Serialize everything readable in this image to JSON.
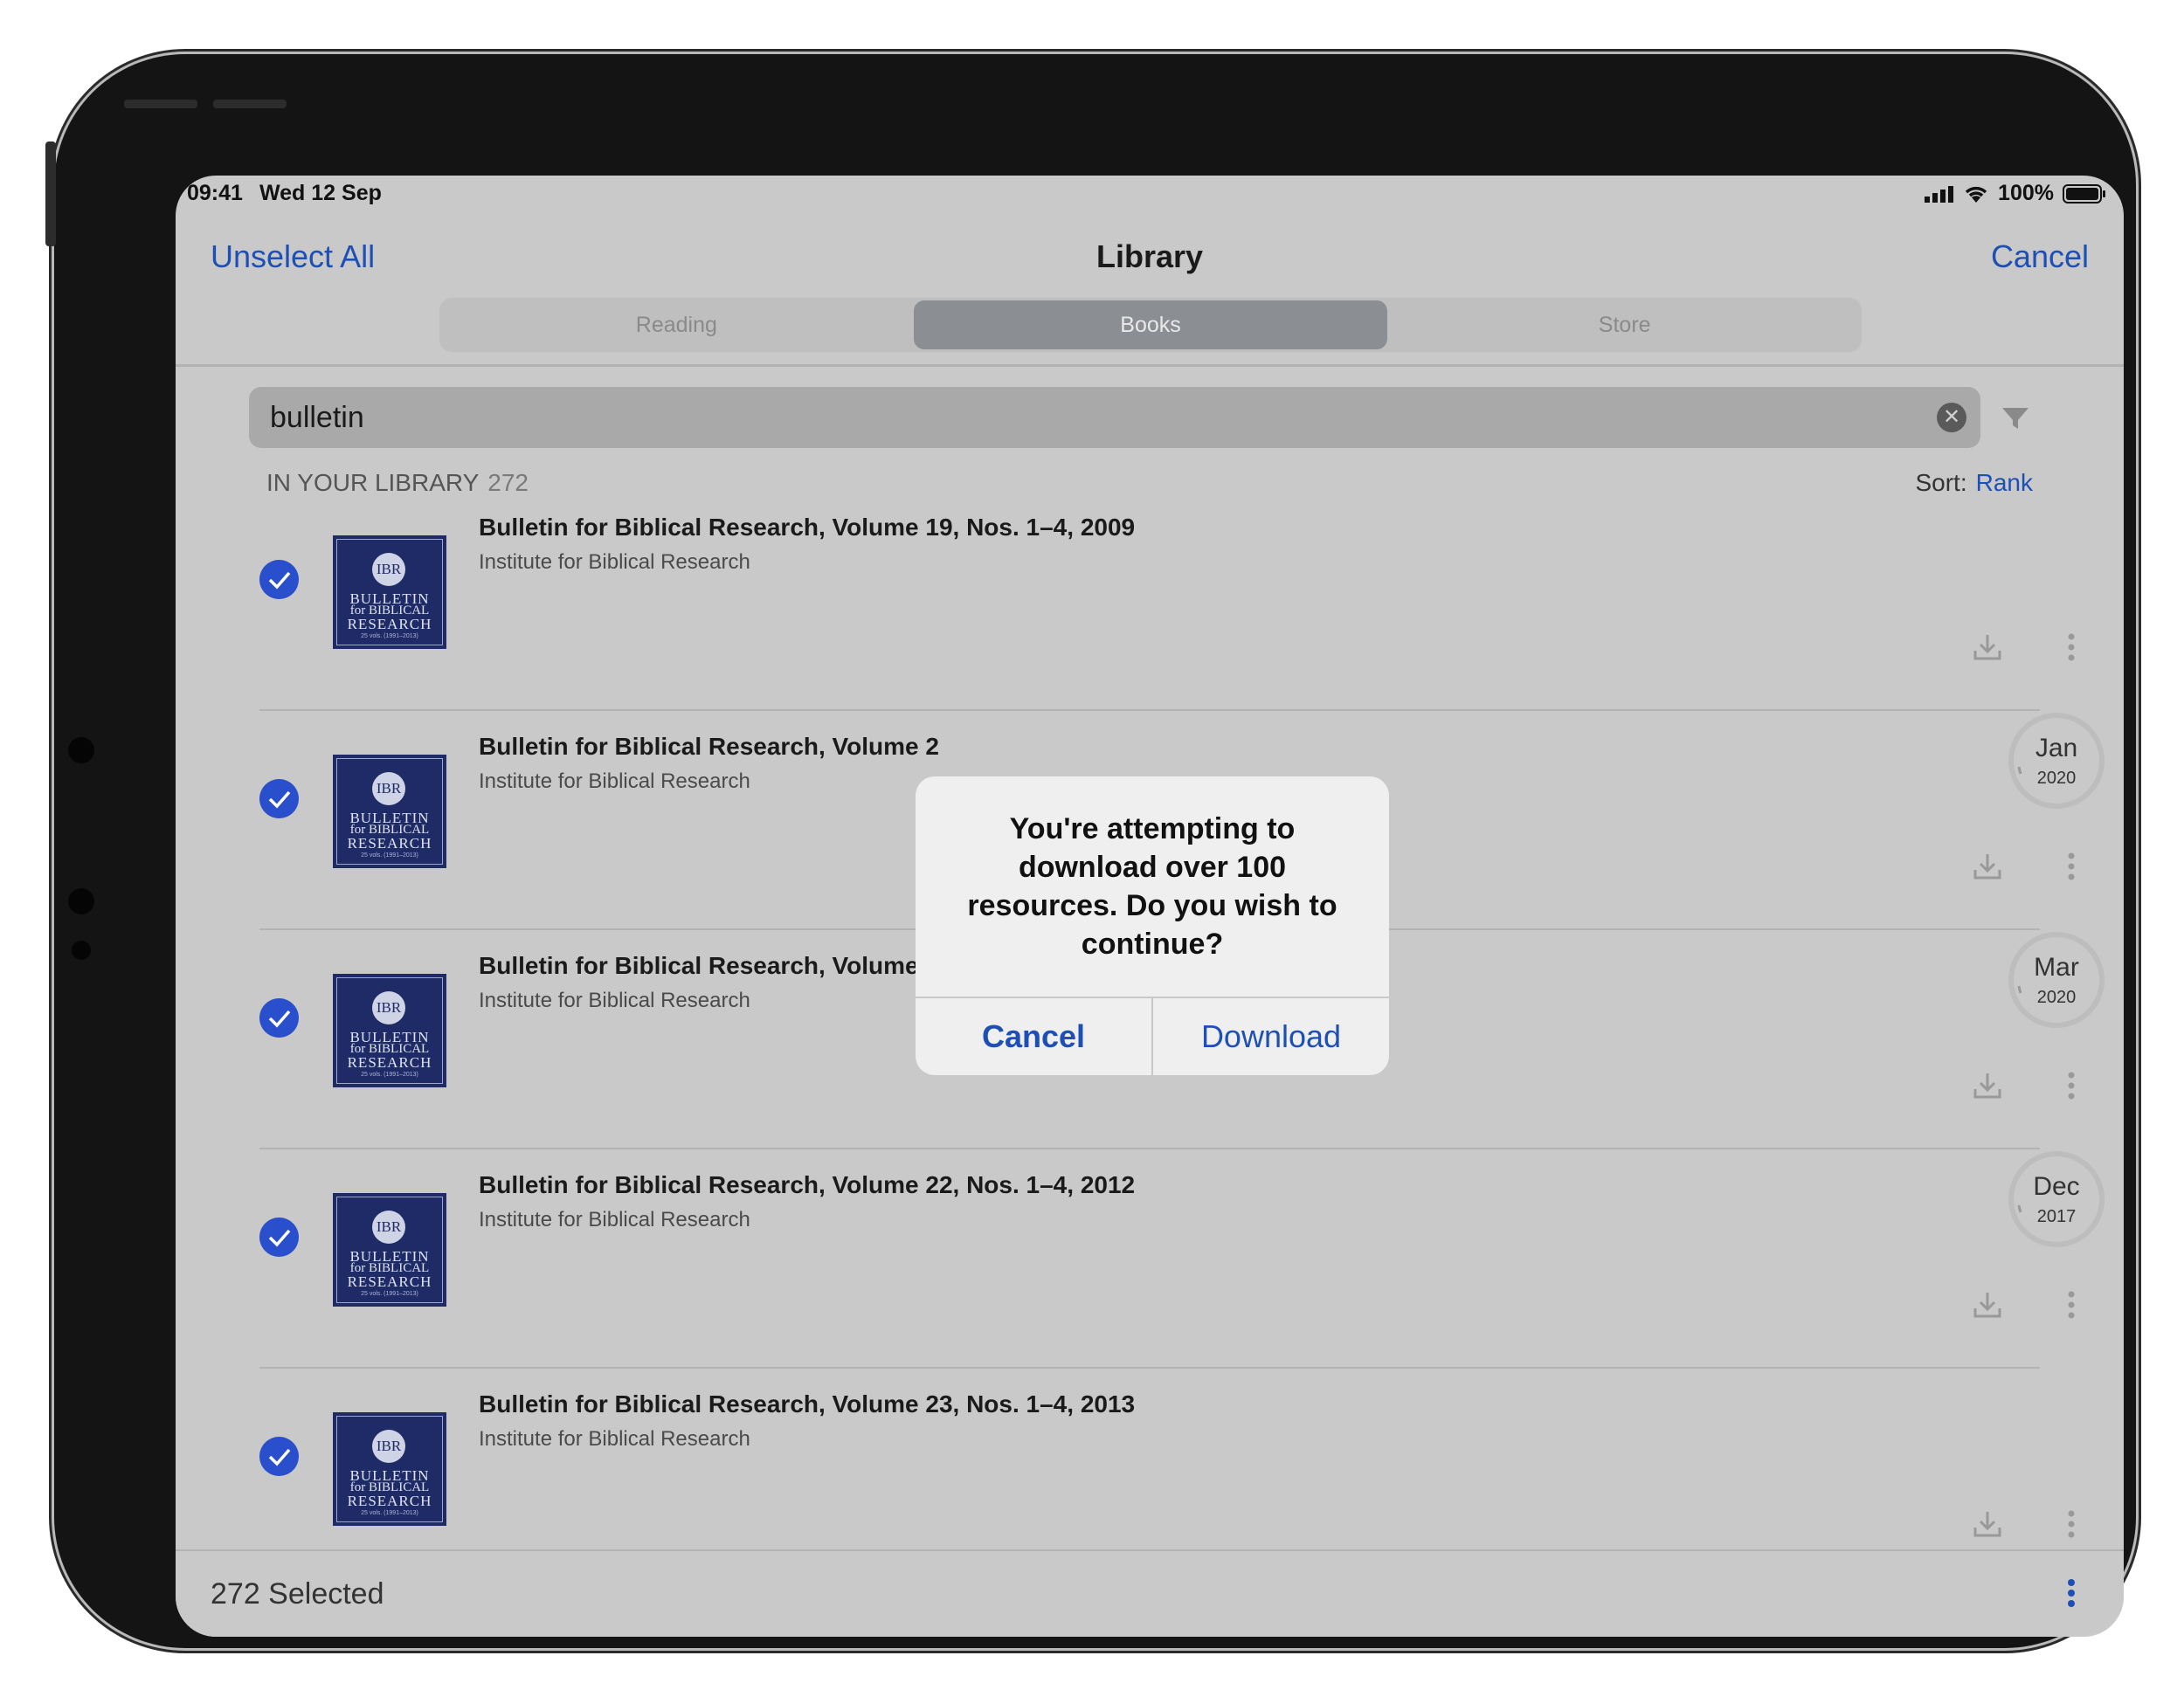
{
  "status": {
    "time": "09:41",
    "date": "Wed 12 Sep",
    "battery": "100%"
  },
  "nav": {
    "left": "Unselect All",
    "title": "Library",
    "right": "Cancel"
  },
  "tabs": [
    {
      "label": "Reading"
    },
    {
      "label": "Books",
      "active": true
    },
    {
      "label": "Store"
    }
  ],
  "search": {
    "value": "bulletin"
  },
  "library": {
    "label": "IN YOUR LIBRARY",
    "count": "272",
    "sort_label": "Sort:",
    "sort_value": "Rank"
  },
  "cover": {
    "seal": "IBR",
    "line1": "BULLETIN",
    "line2": "for BIBLICAL",
    "line3": "RESEARCH",
    "line4": "25 vols. (1991–2013)"
  },
  "items": [
    {
      "title": "Bulletin for Biblical Research, Volume 19, Nos. 1–4, 2009",
      "publisher": "Institute for Biblical Research",
      "badge": null
    },
    {
      "title": "Bulletin for Biblical Research, Volume 2",
      "publisher": "Institute for Biblical Research",
      "badge": {
        "month": "Jan",
        "year": "2020"
      }
    },
    {
      "title": "Bulletin for Biblical Research, Volume 2",
      "publisher": "Institute for Biblical Research",
      "badge": {
        "month": "Mar",
        "year": "2020"
      }
    },
    {
      "title": "Bulletin for Biblical Research, Volume 22, Nos. 1–4, 2012",
      "publisher": "Institute for Biblical Research",
      "badge": {
        "month": "Dec",
        "year": "2017"
      }
    },
    {
      "title": "Bulletin for Biblical Research, Volume 23, Nos. 1–4, 2013",
      "publisher": "Institute for Biblical Research",
      "badge": null
    }
  ],
  "bottom": {
    "selected": "272 Selected"
  },
  "dialog": {
    "message": "You're attempting to download over 100 resources. Do you wish to continue?",
    "cancel": "Cancel",
    "confirm": "Download"
  },
  "colors": {
    "accent": "#1e4fb5",
    "check": "#2a4fcc",
    "cover": "#1e2b66"
  }
}
